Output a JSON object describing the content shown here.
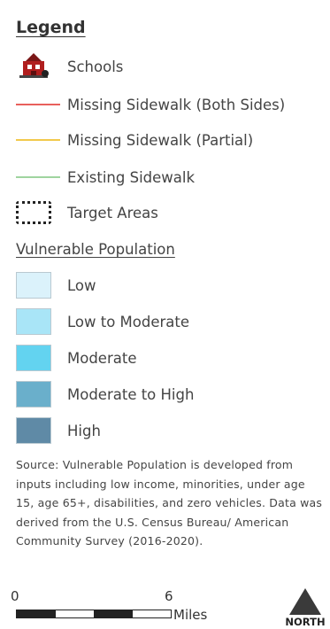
{
  "legend": {
    "title": "Legend",
    "items": [
      {
        "label": "Schools",
        "icon": "school-icon"
      },
      {
        "label": "Missing Sidewalk (Both Sides)",
        "color": "#e8605c"
      },
      {
        "label": "Missing Sidewalk (Partial)",
        "color": "#f2c94c"
      },
      {
        "label": "Existing Sidewalk",
        "color": "#9fd49f"
      },
      {
        "label": "Target Areas",
        "icon": "dotted-box-icon"
      }
    ]
  },
  "vulnerable": {
    "title": "Vulnerable Population",
    "classes": [
      {
        "label": "Low",
        "color": "#dbf2fb"
      },
      {
        "label": "Low to Moderate",
        "color": "#a9e5f7"
      },
      {
        "label": "Moderate",
        "color": "#63d3f0"
      },
      {
        "label": "Moderate to High",
        "color": "#6aafcb"
      },
      {
        "label": "High",
        "color": "#5f8aa6"
      }
    ]
  },
  "source_text": "Source: Vulnerable Population is developed from inputs including low income, minorities, under age 15, age 65+, disabilities, and zero vehicles. Data was derived from the U.S. Census Bureau/ American Community Survey (2016-2020).",
  "scale": {
    "start": "0",
    "end": "6",
    "unit": "Miles"
  },
  "north": {
    "label": "NORTH"
  }
}
